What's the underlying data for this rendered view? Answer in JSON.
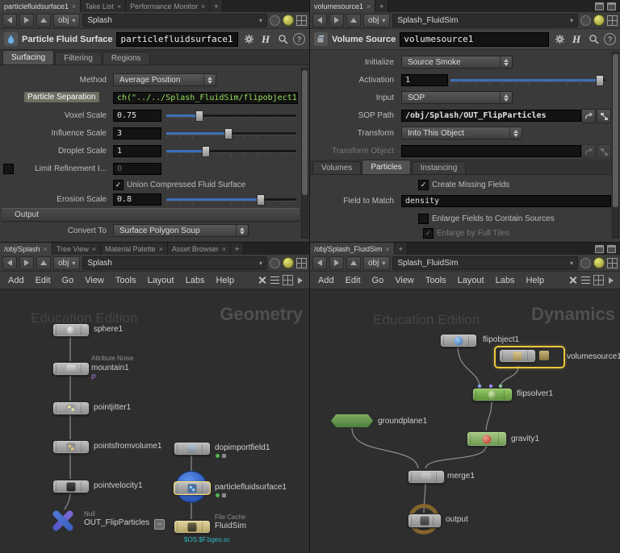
{
  "icons": {
    "close": "×",
    "plus": "+",
    "check": "✓",
    "minus": "−",
    "question": "?",
    "hlogo": "H",
    "chevron_down": "▾"
  },
  "top_left": {
    "tabs": [
      "particlefluidsurface1",
      "Take List",
      "Performance Monitor"
    ],
    "nav": {
      "context": "obj",
      "path": "Splash"
    },
    "header": {
      "type": "Particle Fluid Surface",
      "name": "particlefluidsurface1"
    },
    "param_tabs": [
      "Surfacing",
      "Filtering",
      "Regions"
    ],
    "rows": {
      "method": {
        "label": "Method",
        "value": "Average Position"
      },
      "particle_separation": {
        "label": "Particle Separation",
        "value": "ch(\"../../Splash_FluidSim/flipobject1/pa"
      },
      "voxel_scale": {
        "label": "Voxel Scale",
        "value": "0.75"
      },
      "influence_scale": {
        "label": "Influence Scale",
        "value": "3"
      },
      "droplet_scale": {
        "label": "Droplet Scale",
        "value": "1"
      },
      "limit_refinement": {
        "label": "Limit Refinement I...",
        "value": "0"
      },
      "union_compressed": {
        "label": "Union Compressed Fluid Surface"
      },
      "erosion_scale": {
        "label": "Erosion Scale",
        "value": "0.8"
      },
      "output_section": {
        "label": "Output"
      },
      "convert_to": {
        "label": "Convert To",
        "value": "Surface Polygon Soup"
      }
    }
  },
  "top_right": {
    "tabs": [
      "volumesource1"
    ],
    "nav": {
      "context": "obj",
      "path": "Splash_FluidSim"
    },
    "header": {
      "type": "Volume Source",
      "name": "volumesource1"
    },
    "rows": {
      "initialize": {
        "label": "Initialize",
        "value": "Source Smoke"
      },
      "activation": {
        "label": "Activation",
        "value": "1"
      },
      "input": {
        "label": "Input",
        "value": "SOP"
      },
      "sop_path": {
        "label": "SOP Path",
        "value": "/obj/Splash/OUT_FlipParticles"
      },
      "transform": {
        "label": "Transform",
        "value": "Into This Object"
      },
      "transform_object": {
        "label": "Transform Object",
        "value": ""
      },
      "create_missing": {
        "label": "Create Missing Fields"
      },
      "field_to_match": {
        "label": "Field to Match",
        "value": "density"
      },
      "enlarge_fields": {
        "label": "Enlarge Fields to Contain Sources"
      },
      "enlarge_tiles": {
        "label": "Enlarge by Full Tiles"
      }
    },
    "param_tabs": [
      "Volumes",
      "Particles",
      "Instancing"
    ]
  },
  "bottom_left": {
    "tabs": [
      "/obj/Splash",
      "Tree View",
      "Material Palette",
      "Asset Browser"
    ],
    "nav": {
      "context": "obj",
      "path": "Splash"
    },
    "menus": [
      "Add",
      "Edit",
      "Go",
      "View",
      "Tools",
      "Layout",
      "Labs",
      "Help"
    ],
    "watermark": "Education Edition",
    "context_label": "Geometry",
    "nodes": {
      "sphere1": {
        "label": "sphere1"
      },
      "mountain1": {
        "label": "mountain1",
        "type_label": "Attribute Noise",
        "badge": "P"
      },
      "pointjitter1": {
        "label": "pointjitter1"
      },
      "pointsfromvolume1": {
        "label": "pointsfromvolume1"
      },
      "pointvelocity1": {
        "label": "pointvelocity1"
      },
      "out_flipparticles": {
        "label": "OUT_FlipParticles",
        "type_label": "Null"
      },
      "dopimportfield1": {
        "label": "dopimportfield1"
      },
      "particlefluidsurface1": {
        "label": "particlefluidsurface1"
      },
      "fluidsim": {
        "label": "FluidSim",
        "type_label": "File Cache",
        "path_label": "$OS.$F.bgeo.sc"
      }
    }
  },
  "bottom_right": {
    "tabs": [
      "/obj/Splash_FluidSim"
    ],
    "nav": {
      "context": "obj",
      "path": "Splash_FluidSim"
    },
    "menus": [
      "Add",
      "Edit",
      "Go",
      "View",
      "Tools",
      "Layout",
      "Labs",
      "Help"
    ],
    "watermark": "Education Edition",
    "context_label": "Dynamics",
    "nodes": {
      "flipobject1": {
        "label": "flipobject1"
      },
      "volumesource1": {
        "label": "volumesource1"
      },
      "flipsolver1": {
        "label": "flipsolver1"
      },
      "groundplane1": {
        "label": "groundplane1"
      },
      "gravity1": {
        "label": "gravity1"
      },
      "merge1": {
        "label": "merge1"
      },
      "output": {
        "label": "output"
      }
    }
  }
}
